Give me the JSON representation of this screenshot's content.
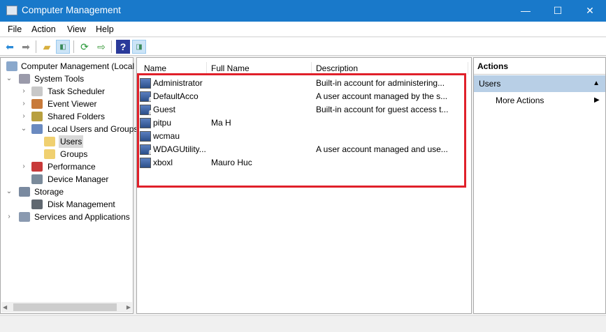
{
  "window": {
    "title": "Computer Management",
    "minimize": "—",
    "maximize": "☐",
    "close": "✕"
  },
  "menu": [
    "File",
    "Action",
    "View",
    "Help"
  ],
  "toolbar": [
    "back-icon",
    "forward-icon",
    "up-folder-icon",
    "show-hide-tree-icon",
    "refresh-icon",
    "export-list-icon",
    "help-icon",
    "show-hide-action-pane-icon"
  ],
  "tree": [
    {
      "label": "Computer Management (Local",
      "level": 0,
      "expander": "",
      "icon": "computer"
    },
    {
      "label": "System Tools",
      "level": 0,
      "expander": "⌄",
      "icon": "tools"
    },
    {
      "label": "Task Scheduler",
      "level": 1,
      "expander": "›",
      "icon": "clock"
    },
    {
      "label": "Event Viewer",
      "level": 1,
      "expander": "›",
      "icon": "event"
    },
    {
      "label": "Shared Folders",
      "level": 1,
      "expander": "›",
      "icon": "share"
    },
    {
      "label": "Local Users and Groups",
      "level": 1,
      "expander": "⌄",
      "icon": "users"
    },
    {
      "label": "Users",
      "level": 2,
      "expander": "",
      "icon": "folder",
      "selected": true
    },
    {
      "label": "Groups",
      "level": 2,
      "expander": "",
      "icon": "folder"
    },
    {
      "label": "Performance",
      "level": 1,
      "expander": "›",
      "icon": "perf"
    },
    {
      "label": "Device Manager",
      "level": 1,
      "expander": "",
      "icon": "device"
    },
    {
      "label": "Storage",
      "level": 0,
      "expander": "⌄",
      "icon": "storage"
    },
    {
      "label": "Disk Management",
      "level": 1,
      "expander": "",
      "icon": "disk"
    },
    {
      "label": "Services and Applications",
      "level": 0,
      "expander": "›",
      "icon": "services"
    }
  ],
  "columns": [
    "Name",
    "Full Name",
    "Description"
  ],
  "users": [
    {
      "name": "Administrator",
      "full_name": "",
      "description": "Built-in account for administering...",
      "disabled": false
    },
    {
      "name": "DefaultAcco",
      "full_name": "",
      "description": "A user account managed by the s...",
      "disabled": true
    },
    {
      "name": "Guest",
      "full_name": "",
      "description": "Built-in account for guest access t...",
      "disabled": true
    },
    {
      "name": "pitpu",
      "full_name": "Ma H",
      "description": "",
      "disabled": false
    },
    {
      "name": "wcmau",
      "full_name": "",
      "description": "",
      "disabled": false
    },
    {
      "name": "WDAGUtility...",
      "full_name": "",
      "description": "A user account managed and use...",
      "disabled": true
    },
    {
      "name": "xboxl",
      "full_name": "Mauro Huc",
      "description": "",
      "disabled": false
    }
  ],
  "actions": {
    "header": "Actions",
    "section": "Users",
    "more": "More Actions",
    "collapse": "▲",
    "arrow": "▶"
  },
  "colors": {
    "titlebar": "#1979ca",
    "highlight": "#e0202a",
    "selection": "#cce8ff"
  }
}
